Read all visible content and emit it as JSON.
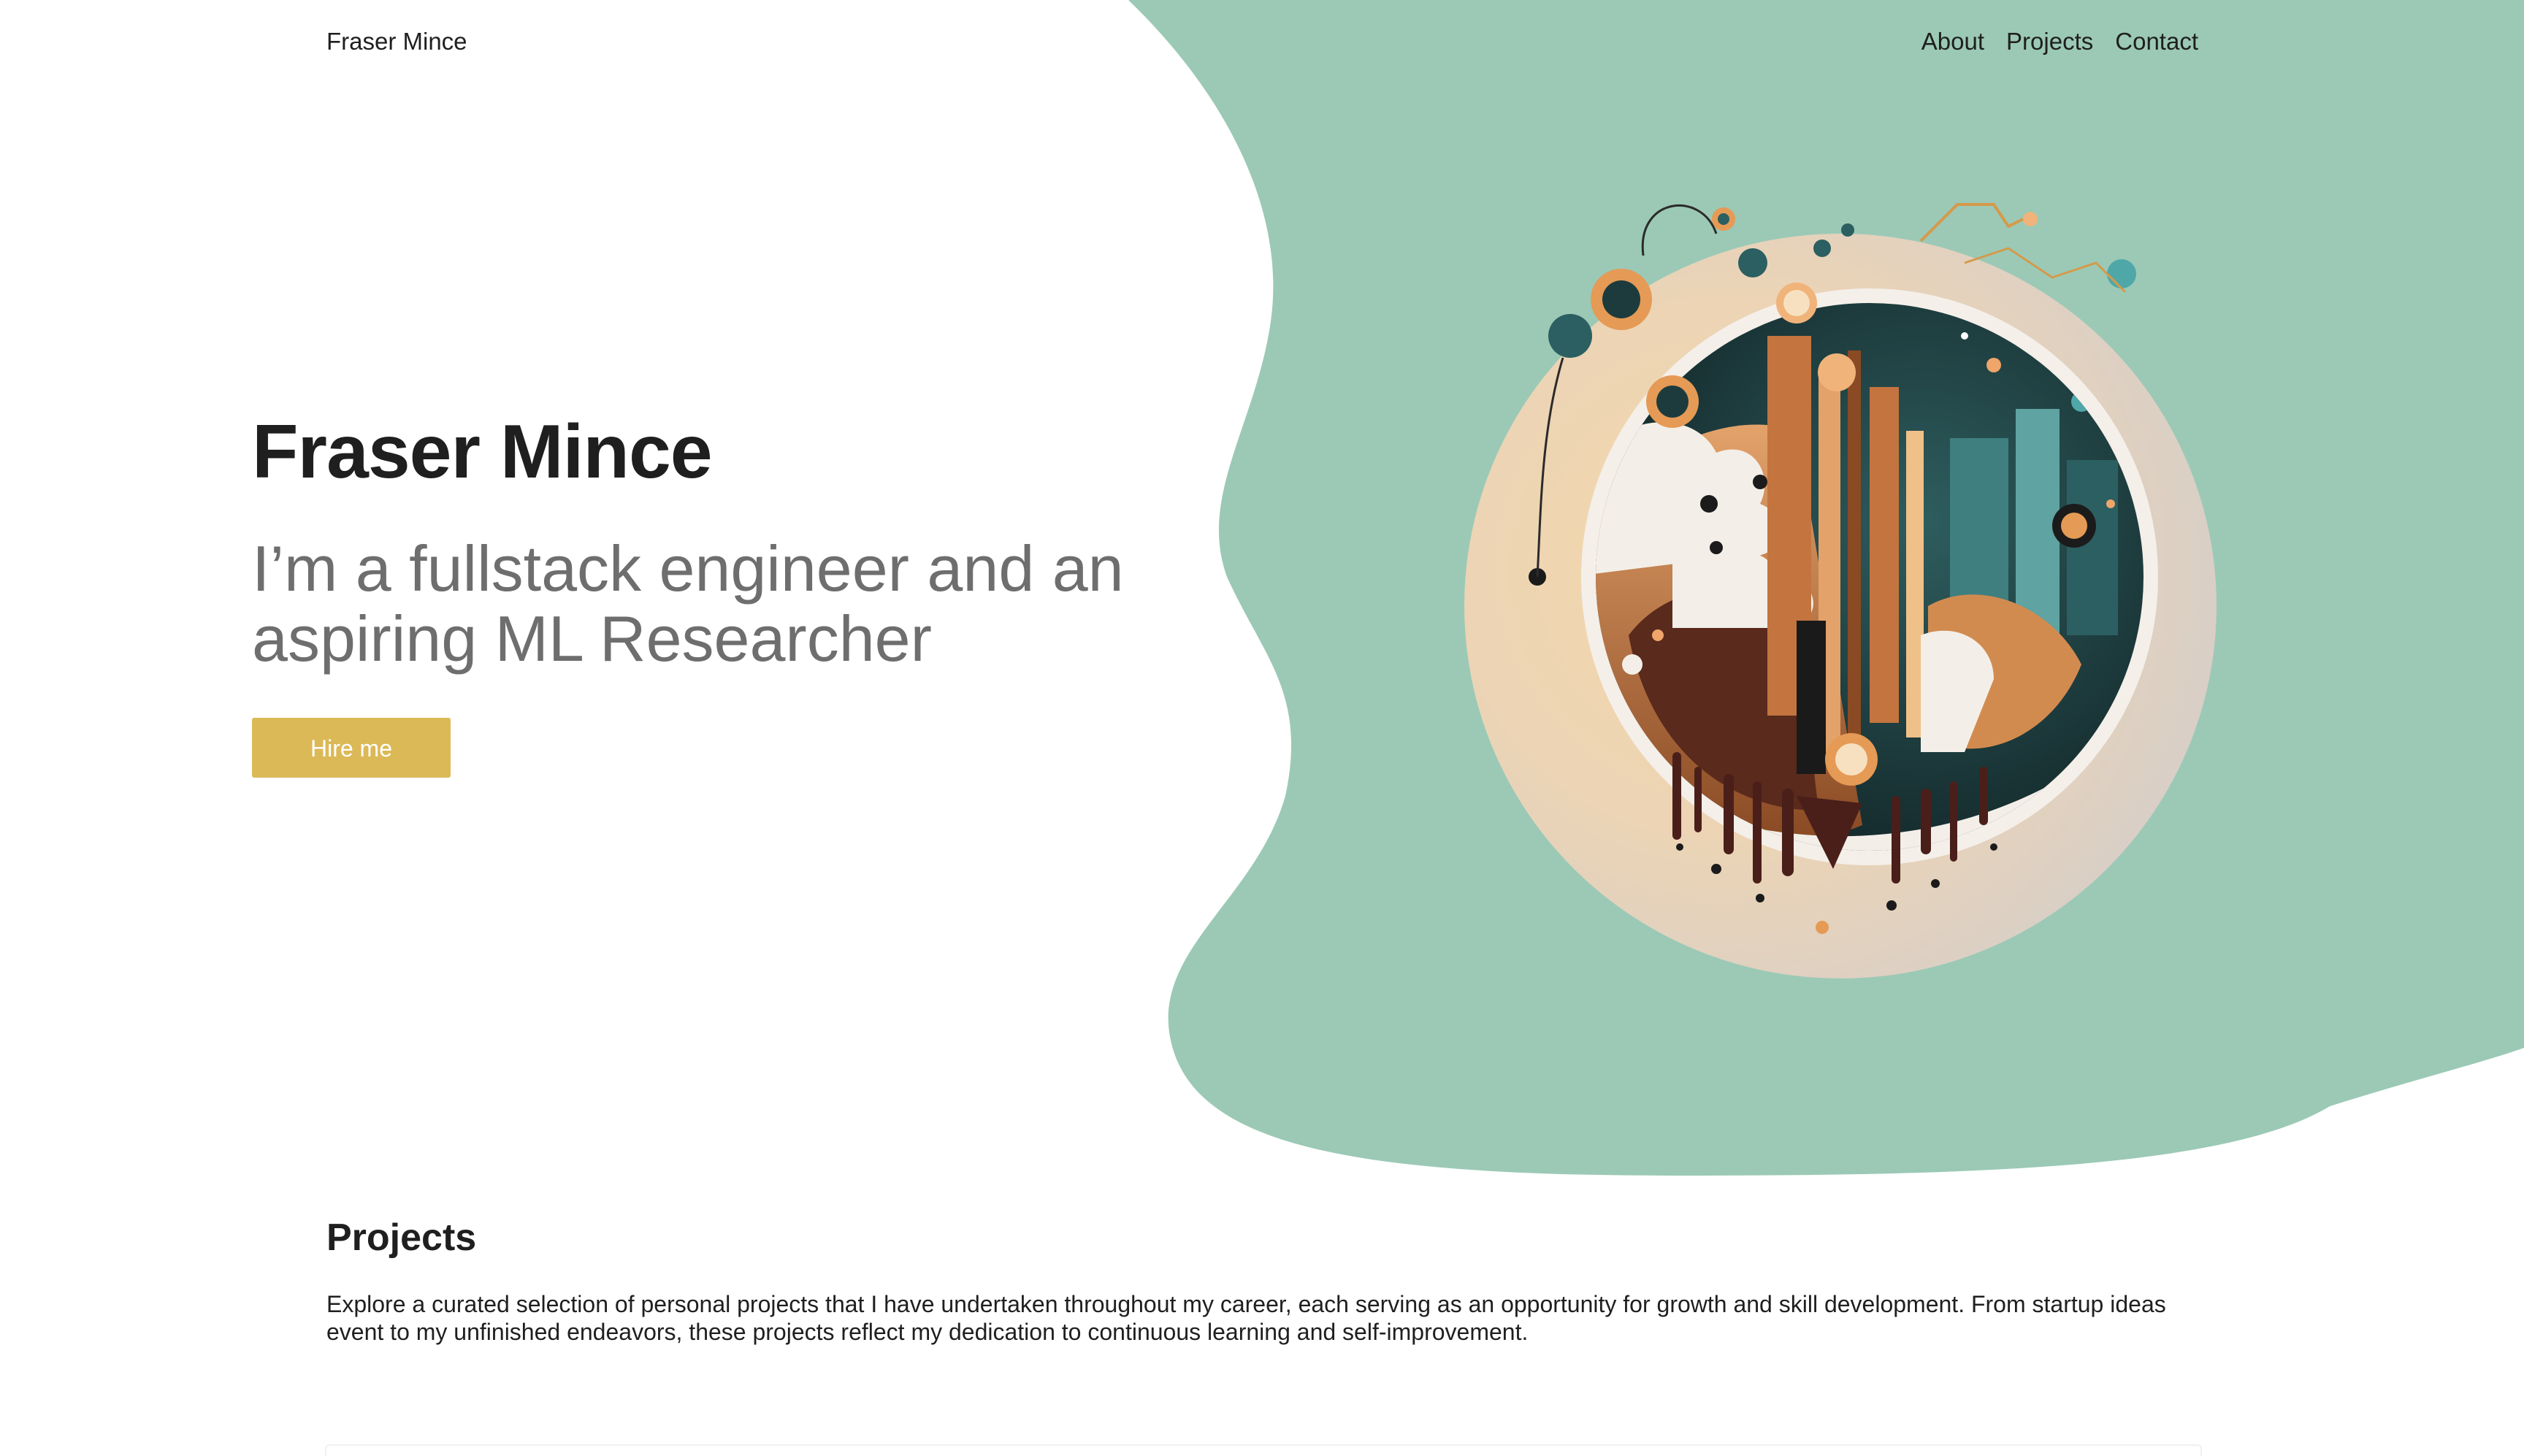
{
  "nav": {
    "brand": "Fraser Mince",
    "links": [
      "About",
      "Projects",
      "Contact"
    ]
  },
  "hero": {
    "title": "Fraser Mince",
    "tagline": "I’m a fullstack engineer and an aspiring ML Researcher",
    "cta_label": "Hire me"
  },
  "projects": {
    "heading": "Projects",
    "description": "Explore a curated selection of personal projects that I have undertaken throughout my career, each serving as an opportunity for growth and skill development. From startup ideas event to my unfinished endeavors, these projects reflect my dedication to continuous learning and self-improvement."
  },
  "colors": {
    "blob": "#9bc9b6",
    "cta": "#dcb957",
    "heading": "#1f1f1f",
    "tagline": "#6e6e6e"
  },
  "icons": {
    "hero_art": "abstract-circuit-planet-illustration"
  }
}
